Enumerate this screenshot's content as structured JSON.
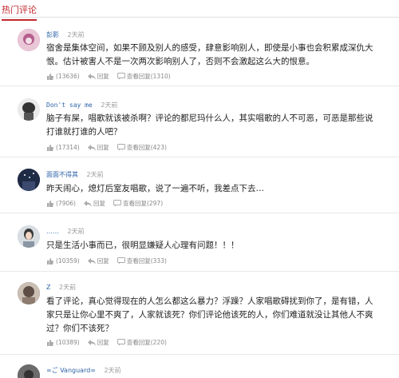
{
  "section": {
    "title": "热门评论"
  },
  "labels": {
    "reply": "回复",
    "view_replies": "查看回复"
  },
  "comments": [
    {
      "user": "彭影",
      "time": "2天前",
      "text": "宿舍是集体空间，如果不顾及别人的感受，肆意影响别人，即使是小事也会积累成深仇大恨。估计被害人不是一次两次影响别人了，否则不会激起这么大的恨意。",
      "likes": "(13636)",
      "reply_count": "(1310)",
      "avatar_color": "#c97fa8"
    },
    {
      "user": "Don't say me",
      "time": "2天前",
      "text": "脑子有屎，唱歌就该被杀啊？评论的都尼玛什么人，其实唱歌的人不可恶，可恶是那些说打谁就打谁的人吧？",
      "likes": "(17314)",
      "reply_count": "(423)",
      "avatar_color": "#4a4a4a"
    },
    {
      "user": "面面不得其",
      "time": "2天前",
      "text": "昨天闹心，熄灯后室友唱歌，说了一遍不听，我差点下去…",
      "likes": "(7906)",
      "reply_count": "(297)",
      "avatar_color": "#2a3552"
    },
    {
      "user": "……",
      "time": "2天前",
      "text": "只是生活小事而已，很明显嫌疑人心理有问题！！！",
      "likes": "(10359)",
      "reply_count": "(333)",
      "avatar_color": "#b8c2cc"
    },
    {
      "user": "Z",
      "time": "2天前",
      "text": "看了评论，真心觉得现在的人怎么都这么暴力？浮躁？人家唱歌碍扰到你了，是有错，人家只是让你心里不爽了，人家就该死？你们评论他该死的人，你们难道就没让其他人不爽过？你们不该死？",
      "likes": "(10389)",
      "reply_count": "(220)",
      "avatar_color": "#7a6a60"
    },
    {
      "user": "∞ご Vanguard∞",
      "time": "2天前",
      "text": "",
      "likes": "",
      "reply_count": "",
      "avatar_color": "#5a5a5a"
    }
  ]
}
